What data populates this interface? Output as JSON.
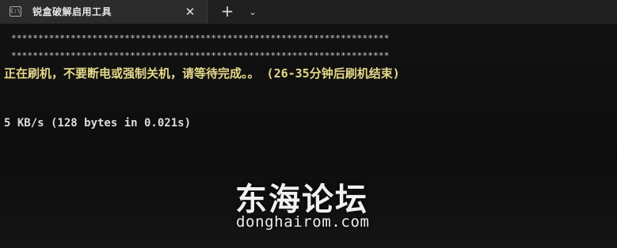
{
  "window": {
    "tab_title": "锐盒破解启用工具",
    "tab_icon": "terminal-icon",
    "close_glyph": "✕",
    "new_tab_glyph": "+",
    "dropdown_glyph": "⌄"
  },
  "terminal": {
    "stars_line_1": "**********************************************************************",
    "stars_line_2": "**********************************************************************",
    "flashing_message": "正在刷机，不要断电或强制关机，请等待完成。。 (26-35分钟后刷机结束)",
    "transfer_stat": "5 KB/s (128 bytes in 0.021s)",
    "colors": {
      "message": "#e5d98a",
      "text": "#d8d8d8",
      "background": "#101010"
    }
  },
  "watermark": {
    "title": "东海论坛",
    "url": "donghairom.com"
  }
}
